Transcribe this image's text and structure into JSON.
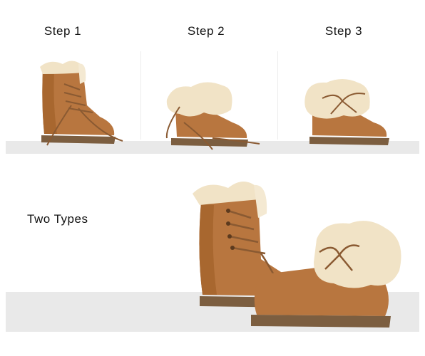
{
  "steps": [
    {
      "label": "Step 1"
    },
    {
      "label": "Step 2"
    },
    {
      "label": "Step 3"
    }
  ],
  "two_types_label": "Two Types",
  "colors": {
    "suede": "#b8763f",
    "suede_dark": "#9c5f2c",
    "fur": "#f1e3c6",
    "sole": "#8a6a48",
    "lace": "#8a5a32",
    "shelf": "#e9e9e9"
  }
}
